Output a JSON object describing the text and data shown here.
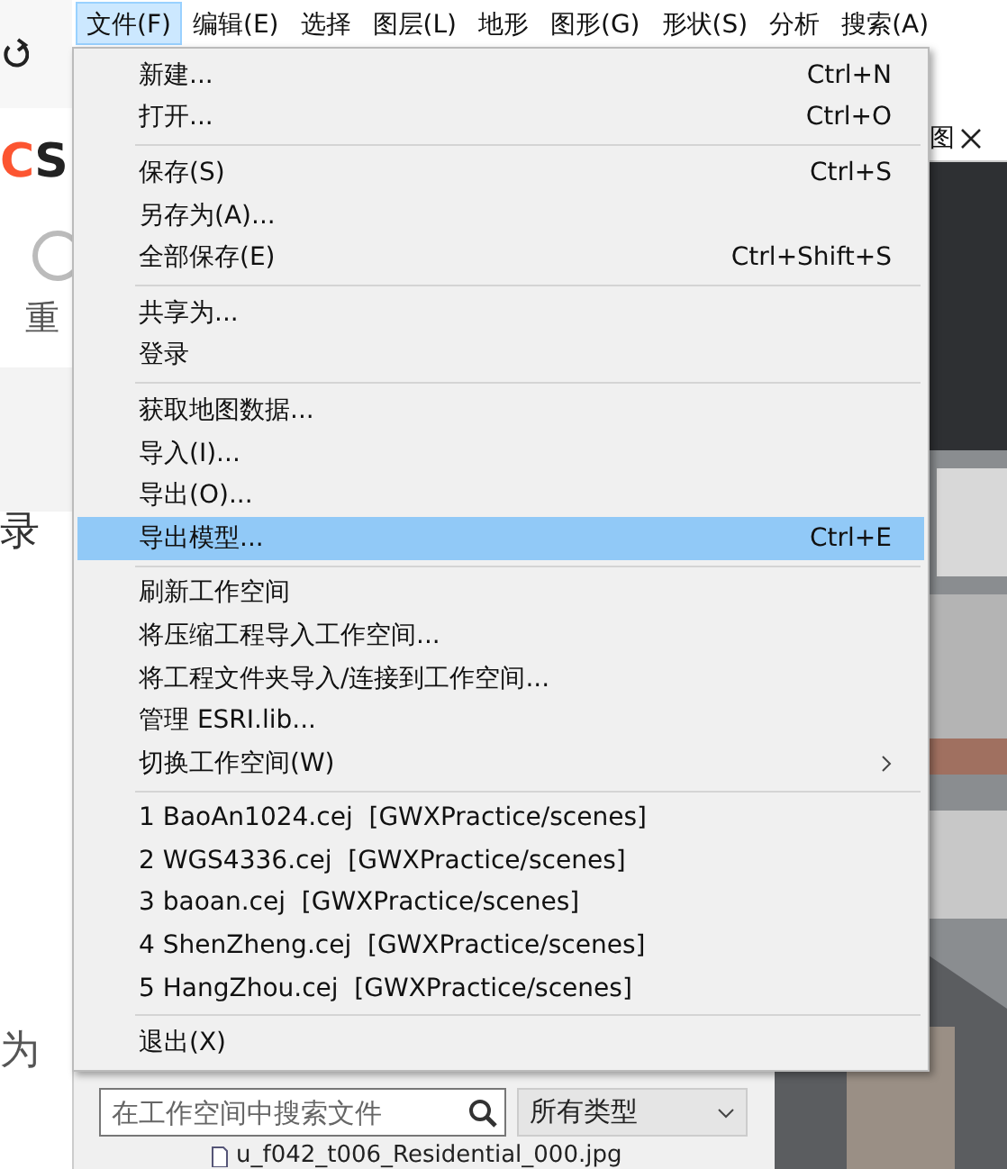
{
  "menubar": [
    {
      "label": "文件(F)",
      "selected": true
    },
    {
      "label": "编辑(E)",
      "selected": false
    },
    {
      "label": "选择",
      "selected": false
    },
    {
      "label": "图层(L)",
      "selected": false
    },
    {
      "label": "地形",
      "selected": false
    },
    {
      "label": "图形(G)",
      "selected": false
    },
    {
      "label": "形状(S)",
      "selected": false
    },
    {
      "label": "分析",
      "selected": false
    },
    {
      "label": "搜索(A)",
      "selected": false
    }
  ],
  "file_menu": [
    {
      "kind": "item",
      "label": "新建...",
      "shortcut": "Ctrl+N",
      "selected": false
    },
    {
      "kind": "item",
      "label": "打开...",
      "shortcut": "Ctrl+O",
      "selected": false
    },
    {
      "kind": "separator"
    },
    {
      "kind": "item",
      "label": "保存(S)",
      "shortcut": "Ctrl+S",
      "selected": false
    },
    {
      "kind": "item",
      "label": "另存为(A)...",
      "selected": false
    },
    {
      "kind": "item",
      "label": "全部保存(E)",
      "shortcut": "Ctrl+Shift+S",
      "selected": false
    },
    {
      "kind": "separator"
    },
    {
      "kind": "item",
      "label": "共享为...",
      "selected": false
    },
    {
      "kind": "item",
      "label": "登录",
      "selected": false
    },
    {
      "kind": "separator"
    },
    {
      "kind": "item",
      "label": "获取地图数据...",
      "selected": false
    },
    {
      "kind": "item",
      "label": "导入(I)...",
      "selected": false
    },
    {
      "kind": "item",
      "label": "导出(O)...",
      "selected": false
    },
    {
      "kind": "item",
      "label": "导出模型...",
      "shortcut": "Ctrl+E",
      "selected": true
    },
    {
      "kind": "separator"
    },
    {
      "kind": "item",
      "label": "刷新工作空间",
      "selected": false
    },
    {
      "kind": "item",
      "label": "将压缩工程导入工作空间...",
      "selected": false
    },
    {
      "kind": "item",
      "label": "将工程文件夹导入/连接到工作空间...",
      "selected": false
    },
    {
      "kind": "item",
      "label": "管理 ESRI.lib...",
      "selected": false
    },
    {
      "kind": "submenu",
      "label": "切换工作空间(W)",
      "selected": false
    },
    {
      "kind": "separator"
    },
    {
      "kind": "item",
      "label": "1 BaoAn1024.cej  [GWXPractice/scenes]",
      "selected": false
    },
    {
      "kind": "item",
      "label": "2 WGS4336.cej  [GWXPractice/scenes]",
      "selected": false
    },
    {
      "kind": "item",
      "label": "3 baoan.cej  [GWXPractice/scenes]",
      "selected": false
    },
    {
      "kind": "item",
      "label": "4 ShenZheng.cej  [GWXPractice/scenes]",
      "selected": false
    },
    {
      "kind": "item",
      "label": "5 HangZhou.cej  [GWXPractice/scenes]",
      "selected": false
    },
    {
      "kind": "separator"
    },
    {
      "kind": "item",
      "label": "退出(X)",
      "selected": false
    }
  ],
  "background_page": {
    "logo": "CS",
    "button_label": "重",
    "heading": "录",
    "text": "为"
  },
  "viewport_tab": {
    "label": "图"
  },
  "navigator": {
    "search": {
      "placeholder": "在工作空间中搜索文件"
    },
    "filter": {
      "value": "所有类型"
    },
    "file": "u_f042_t006_Residential_000.jpg"
  }
}
